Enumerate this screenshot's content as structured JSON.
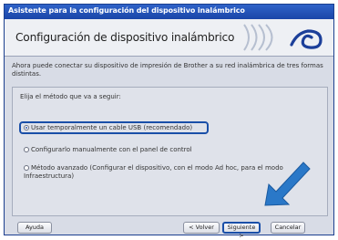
{
  "window": {
    "title": "Asistente para la configuración del dispositivo inalámbrico"
  },
  "header": {
    "title": "Configuración de dispositivo inalámbrico"
  },
  "description": "Ahora puede conectar su dispositivo de impresión de Brother a su red inalámbrica de tres formas distintas.",
  "prompt": "Elija el método que va a seguir:",
  "options": [
    {
      "label": "Usar temporalmente un cable USB (recomendado)",
      "selected": true
    },
    {
      "label": "Configurarlo manualmente con el panel de control",
      "selected": false
    },
    {
      "label": "Método avanzado (Configurar el dispositivo, con el modo Ad hoc, para el modo Infraestructura)",
      "selected": false
    }
  ],
  "buttons": {
    "help": "Ayuda",
    "back": "< Volver",
    "next": "Siguiente >",
    "cancel": "Cancelar"
  },
  "colors": {
    "titlebar": "#1a45a8",
    "highlight": "#1a4fa8",
    "arrow": "#2a78c8"
  },
  "icons": [
    "wireless-waves-icon",
    "arrow-pointer-icon"
  ]
}
